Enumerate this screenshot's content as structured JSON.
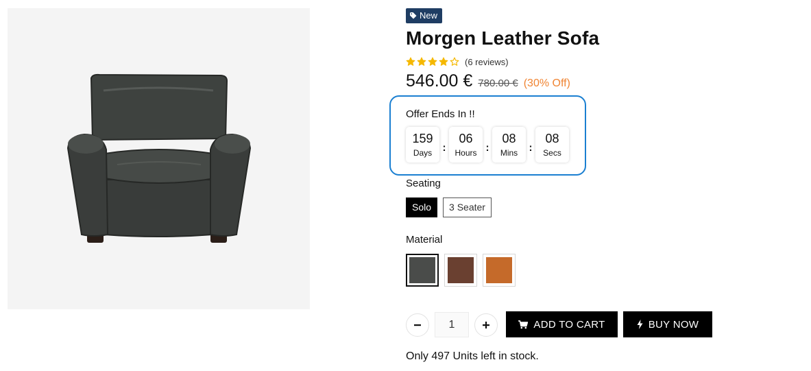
{
  "product": {
    "badge": "New",
    "title": "Morgen Leather Sofa",
    "rating": 4,
    "rating_max": 5,
    "reviews_text": "(6 reviews)",
    "price_current": "546.00 €",
    "price_old": "780.00 €",
    "discount_text": "(30% Off)",
    "image_icon": "armchair-image"
  },
  "offer": {
    "title": "Offer Ends In !!",
    "timer": [
      {
        "value": "159",
        "unit": "Days"
      },
      {
        "value": "06",
        "unit": "Hours"
      },
      {
        "value": "08",
        "unit": "Mins"
      },
      {
        "value": "08",
        "unit": "Secs"
      }
    ],
    "separator": ":"
  },
  "seating": {
    "label": "Seating",
    "options": [
      "Solo",
      "3 Seater"
    ],
    "selected": "Solo"
  },
  "material": {
    "label": "Material",
    "swatches": [
      {
        "name": "dark-grey-leather",
        "color": "#4a4c4a"
      },
      {
        "name": "brown-leather",
        "color": "#6a4030"
      },
      {
        "name": "tan-leather",
        "color": "#c56a2a"
      }
    ],
    "selected_index": 0
  },
  "cart": {
    "quantity": "1",
    "minus_icon": "minus-icon",
    "plus_icon": "plus-icon",
    "add_to_cart_label": "ADD TO CART",
    "add_to_cart_icon": "cart-icon",
    "buy_now_label": "BUY NOW",
    "buy_now_icon": "lightning-icon"
  },
  "stock_text": "Only 497 Units left in stock.",
  "colors": {
    "badge_bg": "#1f3d63",
    "accent_border": "#1a7fd1",
    "discount": "#f08432",
    "star": "#f5b800",
    "button_bg": "#000000"
  }
}
